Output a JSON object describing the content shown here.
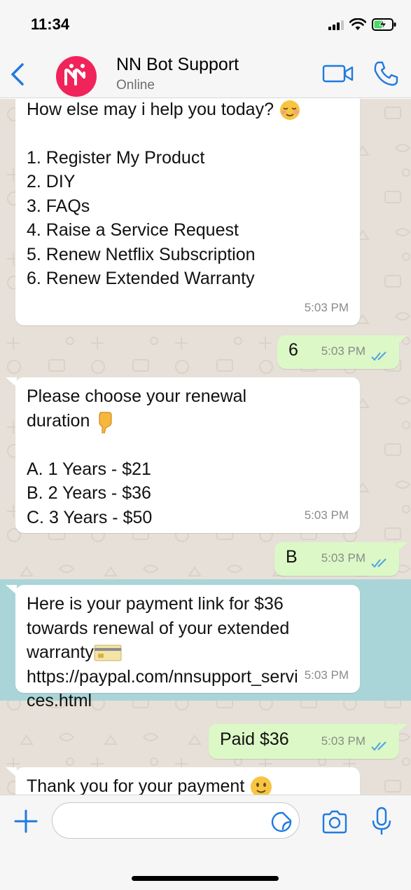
{
  "status_bar": {
    "time": "11:34",
    "icons": [
      "signal-icon",
      "wifi-icon",
      "battery-charging-icon"
    ]
  },
  "header": {
    "contact_name": "NN Bot Support",
    "contact_status": "Online",
    "avatar_icon": "nn-logo-icon",
    "actions": [
      "back-icon",
      "video-call-icon",
      "phone-icon"
    ]
  },
  "messages": [
    {
      "direction": "incoming",
      "text": "How else may i help you today?",
      "emoji": "relieved-face-emoji",
      "list": [
        "1. Register My Product",
        "2. DIY",
        "3. FAQs",
        "4. Raise a Service Request",
        "5. Renew Netflix Subscription",
        "6. Renew Extended Warranty"
      ],
      "time": "5:03 PM"
    },
    {
      "direction": "outgoing",
      "text": "6",
      "time": "5:03 PM",
      "status": "read"
    },
    {
      "direction": "incoming",
      "text": "Please choose your renewal duration",
      "emoji": "pointing-down-emoji",
      "list": [
        "A. 1 Years - $21",
        "B. 2 Years - $36",
        "C. 3 Years - $50"
      ],
      "time": "5:03 PM"
    },
    {
      "direction": "outgoing",
      "text": "B",
      "time": "5:03 PM",
      "status": "read"
    },
    {
      "direction": "incoming",
      "text_before_emoji": "Here is your payment link for $36 towards renewal of your extended warranty",
      "emoji": "credit-card-emoji",
      "link": "https://paypal.com/nnsupport_services.html",
      "link_line1": "https://paypal.com/nnsupport_servi",
      "link_line2": "ces.html",
      "time": "5:03 PM",
      "highlighted": true
    },
    {
      "direction": "outgoing",
      "text": "Paid $36",
      "time": "5:03 PM",
      "status": "read"
    },
    {
      "direction": "incoming",
      "text": "Thank you for your payment",
      "emoji": "slightly-smiling-face-emoji"
    }
  ],
  "input_bar": {
    "placeholder": "",
    "actions": [
      "plus-icon",
      "sticker-icon",
      "camera-icon",
      "microphone-icon"
    ]
  },
  "colors": {
    "accent": "#1f7ae0",
    "chat_background": "#e6e0d8",
    "incoming_bubble": "#ffffff",
    "outgoing_bubble": "#dcf8c6",
    "highlight": "#a9d5d9",
    "read_ticks": "#4fa3e0",
    "avatar": "#f0245a"
  }
}
